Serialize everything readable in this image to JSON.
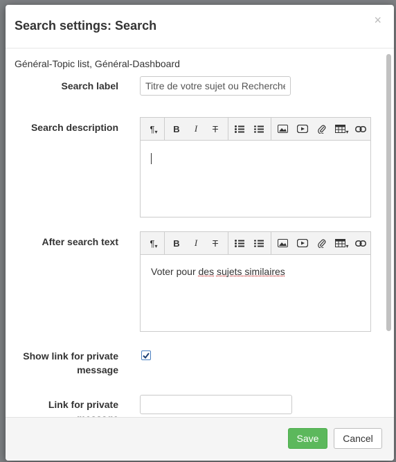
{
  "modal": {
    "title": "Search settings: Search",
    "close_glyph": "×"
  },
  "form": {
    "subtitle": "Général-Topic list, Général-Dashboard",
    "search_label": {
      "label": "Search label",
      "value": "Titre de votre sujet ou Recherche"
    },
    "search_description": {
      "label": "Search description",
      "value": ""
    },
    "after_search_text": {
      "label": "After search text",
      "value_prefix": "Voter pour ",
      "value_misspelled_1": "des",
      "value_space": " ",
      "value_misspelled_2": "sujets similaires"
    },
    "show_link_private": {
      "label_line1": "Show link for private",
      "label_line2": "message",
      "checked": true
    },
    "link_private": {
      "label_line1": "Link for private",
      "label_line2": "message",
      "value": ""
    }
  },
  "editor_toolbar": {
    "icons": [
      "paragraph-icon",
      "bold-icon",
      "italic-icon",
      "strikethrough-icon",
      "bullet-list-icon",
      "numbered-list-icon",
      "image-icon",
      "video-icon",
      "attachment-icon",
      "table-icon",
      "link-icon"
    ],
    "bold": "B",
    "italic": "I",
    "strike": "T",
    "paragraph": "¶"
  },
  "footer": {
    "save_label": "Save",
    "cancel_label": "Cancel"
  },
  "colors": {
    "save_button": "#5cb85c",
    "checkbox": "#4a7fc0"
  }
}
